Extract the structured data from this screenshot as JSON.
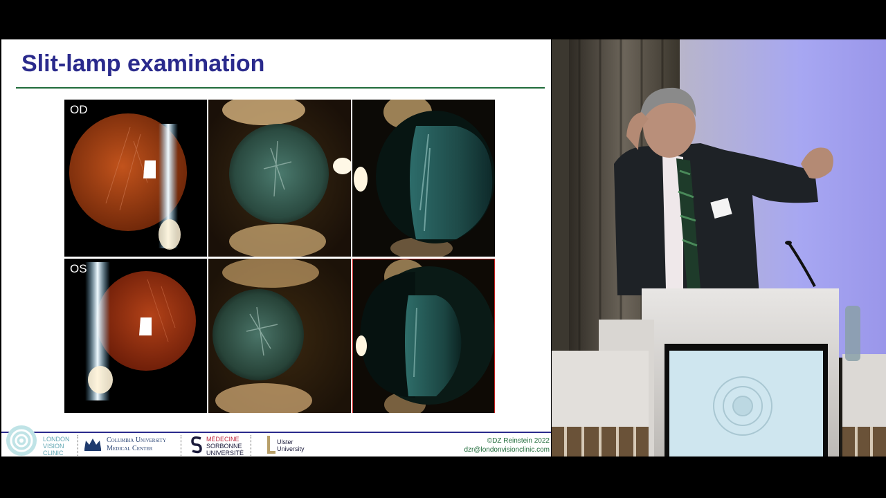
{
  "slide": {
    "title": "Slit-lamp examination",
    "labels": {
      "od": "OD",
      "os": "OS"
    },
    "footer": {
      "lvc": [
        "LONDON",
        "VISION",
        "CLINIC"
      ],
      "columbia": [
        "Columbia University",
        "Medical Center"
      ],
      "sorbonne": [
        "MÉDECINE",
        "SORBONNE",
        "UNIVERSITÉ"
      ],
      "ulster": [
        "Ulster",
        "University"
      ],
      "copyright": "©DZ Reinstein 2022",
      "email": "dzr@londonvisionclinic.com"
    }
  },
  "colors": {
    "title": "#2a2a8c",
    "rule": "#1f6b3a",
    "credit": "#1f6b3a"
  }
}
